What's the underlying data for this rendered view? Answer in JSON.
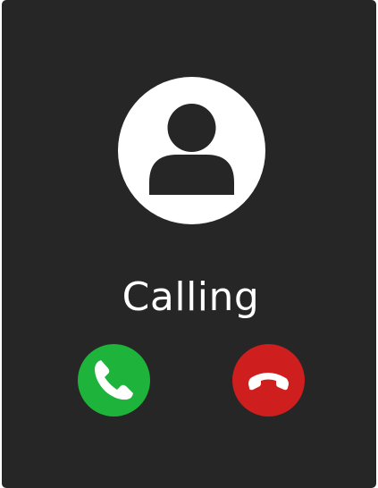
{
  "call": {
    "status": "Calling"
  },
  "icons": {
    "avatar": "user-silhouette-icon",
    "accept": "phone-handset-icon",
    "decline": "phone-hangup-icon"
  },
  "colors": {
    "background": "#262626",
    "avatar_background": "#ffffff",
    "avatar_figure": "#262626",
    "text": "#ffffff",
    "accept_button": "#1eb33a",
    "decline_button": "#cf1e1e",
    "icon": "#ffffff"
  }
}
